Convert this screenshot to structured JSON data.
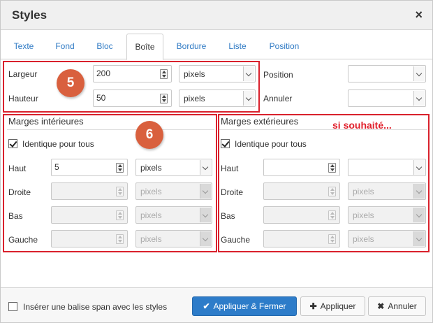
{
  "dialog": {
    "title": "Styles",
    "close_symbol": "×"
  },
  "tabs": [
    "Texte",
    "Fond",
    "Bloc",
    "Boîte",
    "Bordure",
    "Liste",
    "Position"
  ],
  "active_tab": "Boîte",
  "box": {
    "largeur_label": "Largeur",
    "largeur_value": "200",
    "largeur_unit": "pixels",
    "hauteur_label": "Hauteur",
    "hauteur_value": "50",
    "hauteur_unit": "pixels",
    "position_label": "Position",
    "position_value": "",
    "annuler_label": "Annuler",
    "annuler_value": ""
  },
  "padding": {
    "legend": "Marges intérieures",
    "same_label": "Identique pour tous",
    "same_checked": true,
    "rows": [
      {
        "label": "Haut",
        "value": "5",
        "unit": "pixels",
        "disabled": false
      },
      {
        "label": "Droite",
        "value": "",
        "unit": "pixels",
        "disabled": true
      },
      {
        "label": "Bas",
        "value": "",
        "unit": "pixels",
        "disabled": true
      },
      {
        "label": "Gauche",
        "value": "",
        "unit": "pixels",
        "disabled": true
      }
    ]
  },
  "margin": {
    "legend": "Marges extérieures",
    "same_label": "Identique pour tous",
    "same_checked": true,
    "rows": [
      {
        "label": "Haut",
        "value": "",
        "unit": "",
        "disabled": false
      },
      {
        "label": "Droite",
        "value": "",
        "unit": "pixels",
        "disabled": true
      },
      {
        "label": "Bas",
        "value": "",
        "unit": "pixels",
        "disabled": true
      },
      {
        "label": "Gauche",
        "value": "",
        "unit": "pixels",
        "disabled": true
      }
    ]
  },
  "annotations": {
    "badge_5": "5",
    "badge_6": "6",
    "note": "si souhaité..."
  },
  "footer": {
    "span_label": "Insérer une balise span avec les styles",
    "span_checked": false,
    "apply_close": "Appliquer & Fermer",
    "apply": "Appliquer",
    "cancel": "Annuler"
  },
  "colors": {
    "accent": "#2d7cc9",
    "annotation_red": "#d9212c",
    "badge": "#d9603e",
    "tab_link": "#2f7ac4"
  }
}
